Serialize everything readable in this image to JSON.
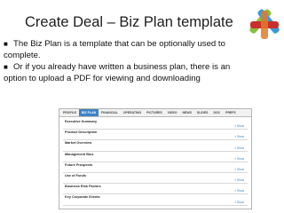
{
  "title": "Create Deal – Biz Plan template",
  "bullets": [
    "The Biz Plan is a template that can be optionally used to complete.",
    "Or if you already have written a business plan, there is an option to upload a PDF for viewing and downloading"
  ],
  "colors": {
    "accent": "#3f83c4",
    "link": "#2f86c9",
    "logo": [
      "#c9302c",
      "#8cbf3f",
      "#3a9ad9",
      "#e07a2a"
    ]
  },
  "screenshot": {
    "tabs": [
      "PROFILE",
      "BIZ PLAN",
      "FINANCIAL",
      "OPERATING",
      "PICTURES",
      "VIDEO",
      "NEWS",
      "SLIDES",
      "DOC",
      "PREFS"
    ],
    "active_tab": "BIZ PLAN",
    "sections": [
      {
        "title": "Executive Summary",
        "link": "» Show"
      },
      {
        "title": "Product Description",
        "link": "» Show"
      },
      {
        "title": "Market Overview",
        "link": "» Show"
      },
      {
        "title": "Management Bios",
        "link": "» Show"
      },
      {
        "title": "Future Prospects",
        "link": "» Show"
      },
      {
        "title": "Use of Funds",
        "link": "» Show"
      },
      {
        "title": "Business Risk Factors",
        "link": "» Show"
      },
      {
        "title": "Key Corporate Events",
        "link": "» Show"
      }
    ]
  }
}
